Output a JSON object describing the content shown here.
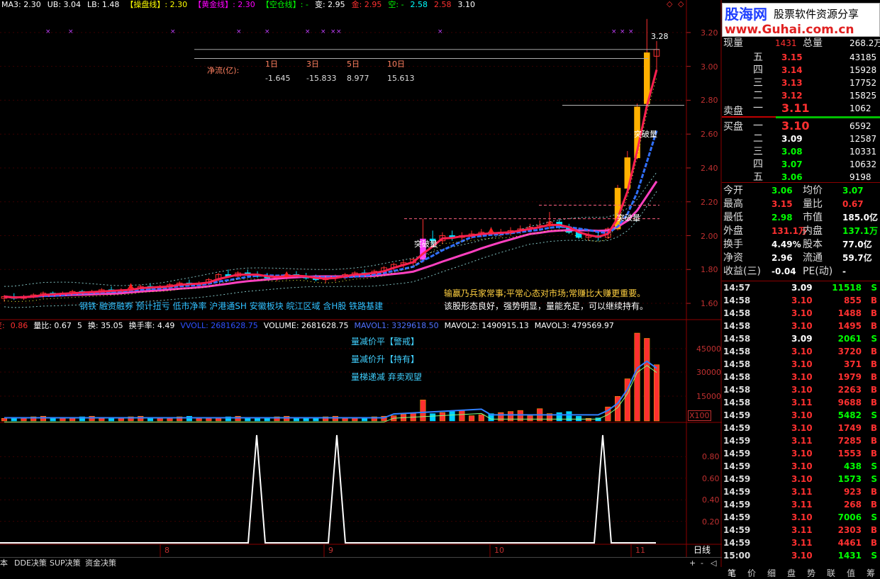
{
  "colors": {
    "up": "#ff3030",
    "down": "#00ffff",
    "neutral": "#ffffff",
    "bg": "#000000",
    "grid": "#8b0000",
    "accent": "#ff00ff",
    "yellow": "#ffff00",
    "green": "#00ff00"
  },
  "header": {
    "items": [
      {
        "t": "MA3: 2.30",
        "c": "#ffffff"
      },
      {
        "t": "UB: 3.04",
        "c": "#ffffff"
      },
      {
        "t": "LB: 1.48",
        "c": "#ffffff"
      },
      {
        "t": "【操盘线】: 2.30",
        "c": "#ffff00"
      },
      {
        "t": "【黄金线】: 2.30",
        "c": "#ff00ff"
      },
      {
        "t": "【空仓线】: -",
        "c": "#00ff00"
      },
      {
        "t": "变: 2.95",
        "c": "#ffffff"
      },
      {
        "t": "金: 2.95",
        "c": "#ff3030"
      },
      {
        "t": "空: -",
        "c": "#00ff00"
      },
      {
        "t": "2.58",
        "c": "#00ffff"
      },
      {
        "t": "2.58",
        "c": "#ff3030"
      },
      {
        "t": "3.10",
        "c": "#ffffff"
      }
    ]
  },
  "netflow": {
    "label": "净流(亿):",
    "cols": [
      "1日",
      "3日",
      "5日",
      "10日"
    ],
    "vals": [
      "-1.645",
      "-15.833",
      "8.977",
      "15.613"
    ]
  },
  "annotations": {
    "breakthrough": "突破量",
    "high_price": "3.28",
    "concepts": "钢铁 融资融券 预计扭亏 低市净率 沪港通SH 安徽板块 皖江区域 含H股 铁路基建",
    "comment1": "输赢乃兵家常事;平常心态对市场;常赚比大赚更重要。",
    "comment2": "该股形态良好，强势明显，量能充足，可以继续持有。"
  },
  "price_axis": [
    "3.20",
    "3.00",
    "2.80",
    "2.60",
    "2.40",
    "2.20",
    "2.00",
    "1.80",
    "1.60"
  ],
  "volume_header": [
    {
      "t": "变:",
      "c": "#ff3030"
    },
    {
      "t": "0.86",
      "c": "#ff3030"
    },
    {
      "t": "量比: 0.67",
      "c": "#ffffff"
    },
    {
      "t": "5",
      "c": "#ffffff"
    },
    {
      "t": "换: 35.05",
      "c": "#ffffff"
    },
    {
      "t": "换手率: 4.49",
      "c": "#ffffff"
    },
    {
      "t": "VVOLL: 2681628.75",
      "c": "#3050ff"
    },
    {
      "t": "VOLUME: 2681628.75",
      "c": "#ffffff"
    },
    {
      "t": "MAVOL1: 3329618.50",
      "c": "#5070ff"
    },
    {
      "t": "MAVOL2: 1490915.13",
      "c": "#ffffff"
    },
    {
      "t": "MAVOL3: 479569.97",
      "c": "#ffffff"
    }
  ],
  "volume_signals": [
    "量减价平【警戒】",
    "量减价升【持有】",
    "量梯递减 弃卖观望"
  ],
  "volume_axis": [
    "45000",
    "30000",
    "15000",
    "X100"
  ],
  "indicator_axis": [
    "0.80",
    "0.60",
    "0.40",
    "0.20"
  ],
  "date_axis": {
    "labels": [
      "8",
      "9",
      "10",
      "11"
    ],
    "period": "日线"
  },
  "bottom_tabs": [
    "本",
    "DDE决策",
    "SUP决策",
    "资金决策"
  ],
  "scroll_buttons": [
    "+",
    "-",
    "◁",
    "▷"
  ],
  "logo": {
    "title": "股海网",
    "subtitle": "股票软件资源分享",
    "url": "www.Guhai.com.cn"
  },
  "quote": {
    "top": [
      {
        "l": "现量",
        "v": "1431",
        "l2": "总量",
        "v2": "268.2万"
      }
    ],
    "sell": [
      {
        "l": "五",
        "p": "3.15",
        "v": "43185"
      },
      {
        "l": "四",
        "p": "3.14",
        "v": "15928"
      },
      {
        "l": "三",
        "p": "3.13",
        "v": "17752"
      },
      {
        "l": "二",
        "p": "3.12",
        "v": "15825"
      },
      {
        "l": "一",
        "p": "3.11",
        "v": "1062"
      }
    ],
    "sell_label": "卖盘",
    "buy_label": "买盘",
    "buy": [
      {
        "l": "一",
        "p": "3.10",
        "v": "6592"
      },
      {
        "l": "二",
        "p": "3.09",
        "v": "12587"
      },
      {
        "l": "三",
        "p": "3.08",
        "v": "10331"
      },
      {
        "l": "四",
        "p": "3.07",
        "v": "10632"
      },
      {
        "l": "五",
        "p": "3.06",
        "v": "9198"
      }
    ],
    "stats": [
      {
        "l": "今开",
        "v": "3.06",
        "c": "#00ff00",
        "l2": "均价",
        "v2": "3.07",
        "c2": "#00ff00"
      },
      {
        "l": "最高",
        "v": "3.15",
        "c": "#ff3030",
        "l2": "量比",
        "v2": "0.67",
        "c2": "#ff3030"
      },
      {
        "l": "最低",
        "v": "2.98",
        "c": "#00ff00",
        "l2": "市值",
        "v2": "185.0亿",
        "c2": "#ffffff"
      },
      {
        "l": "外盘",
        "v": "131.1万",
        "c": "#ff3030",
        "l2": "内盘",
        "v2": "137.1万",
        "c2": "#00ff00"
      },
      {
        "l": "换手",
        "v": "4.49%",
        "c": "#ffffff",
        "l2": "股本",
        "v2": "77.0亿",
        "c2": "#ffffff"
      },
      {
        "l": "净资",
        "v": "2.96",
        "c": "#ffffff",
        "l2": "流通",
        "v2": "59.7亿",
        "c2": "#ffffff"
      },
      {
        "l": "收益(三)",
        "v": "-0.04",
        "c": "#ffffff",
        "l2": "PE(动)",
        "v2": "-",
        "c2": "#ffffff"
      }
    ]
  },
  "ticks": [
    {
      "t": "14:57",
      "p": "3.09",
      "v": "11518",
      "d": "S"
    },
    {
      "t": "14:58",
      "p": "3.10",
      "v": "855",
      "d": "B"
    },
    {
      "t": "14:58",
      "p": "3.10",
      "v": "1488",
      "d": "B"
    },
    {
      "t": "14:58",
      "p": "3.10",
      "v": "1495",
      "d": "B"
    },
    {
      "t": "14:58",
      "p": "3.09",
      "v": "2061",
      "d": "S"
    },
    {
      "t": "14:58",
      "p": "3.10",
      "v": "3720",
      "d": "B"
    },
    {
      "t": "14:58",
      "p": "3.10",
      "v": "371",
      "d": "B"
    },
    {
      "t": "14:58",
      "p": "3.10",
      "v": "1979",
      "d": "B"
    },
    {
      "t": "14:58",
      "p": "3.10",
      "v": "2263",
      "d": "B"
    },
    {
      "t": "14:58",
      "p": "3.11",
      "v": "9688",
      "d": "B"
    },
    {
      "t": "14:59",
      "p": "3.10",
      "v": "5482",
      "d": "S"
    },
    {
      "t": "14:59",
      "p": "3.10",
      "v": "1749",
      "d": "B"
    },
    {
      "t": "14:59",
      "p": "3.11",
      "v": "7285",
      "d": "B"
    },
    {
      "t": "14:59",
      "p": "3.10",
      "v": "1553",
      "d": "B"
    },
    {
      "t": "14:59",
      "p": "3.10",
      "v": "438",
      "d": "S"
    },
    {
      "t": "14:59",
      "p": "3.10",
      "v": "1573",
      "d": "S"
    },
    {
      "t": "14:59",
      "p": "3.11",
      "v": "923",
      "d": "B"
    },
    {
      "t": "14:59",
      "p": "3.11",
      "v": "268",
      "d": "B"
    },
    {
      "t": "14:59",
      "p": "3.10",
      "v": "7006",
      "d": "S"
    },
    {
      "t": "14:59",
      "p": "3.11",
      "v": "2303",
      "d": "B"
    },
    {
      "t": "14:59",
      "p": "3.11",
      "v": "4461",
      "d": "B"
    },
    {
      "t": "15:00",
      "p": "3.10",
      "v": "1431",
      "d": "S"
    }
  ],
  "side_tabs": [
    "笔",
    "价",
    "细",
    "盘",
    "势",
    "联",
    "值",
    "筹"
  ],
  "chart_data": {
    "type": "candlestick",
    "ylim": [
      1.55,
      3.3
    ],
    "candles": [
      [
        1.63,
        1.65,
        1.61,
        1.64
      ],
      [
        1.64,
        1.66,
        1.62,
        1.63
      ],
      [
        1.63,
        1.65,
        1.62,
        1.64
      ],
      [
        1.64,
        1.66,
        1.63,
        1.65
      ],
      [
        1.65,
        1.67,
        1.63,
        1.66
      ],
      [
        1.66,
        1.67,
        1.64,
        1.65
      ],
      [
        1.65,
        1.67,
        1.64,
        1.66
      ],
      [
        1.66,
        1.68,
        1.65,
        1.67
      ],
      [
        1.67,
        1.68,
        1.65,
        1.66
      ],
      [
        1.66,
        1.68,
        1.65,
        1.67
      ],
      [
        1.67,
        1.69,
        1.66,
        1.68
      ],
      [
        1.68,
        1.7,
        1.66,
        1.67
      ],
      [
        1.67,
        1.69,
        1.66,
        1.68
      ],
      [
        1.68,
        1.7,
        1.67,
        1.69
      ],
      [
        1.69,
        1.71,
        1.67,
        1.7
      ],
      [
        1.7,
        1.72,
        1.68,
        1.69
      ],
      [
        1.69,
        1.71,
        1.68,
        1.7
      ],
      [
        1.7,
        1.72,
        1.69,
        1.71
      ],
      [
        1.71,
        1.73,
        1.7,
        1.72
      ],
      [
        1.72,
        1.74,
        1.7,
        1.71
      ],
      [
        1.71,
        1.73,
        1.7,
        1.72
      ],
      [
        1.72,
        1.75,
        1.71,
        1.74
      ],
      [
        1.74,
        1.78,
        1.73,
        1.77
      ],
      [
        1.77,
        1.8,
        1.75,
        1.76
      ],
      [
        1.76,
        1.79,
        1.74,
        1.78
      ],
      [
        1.78,
        1.8,
        1.76,
        1.77
      ],
      [
        1.77,
        1.79,
        1.75,
        1.76
      ],
      [
        1.76,
        1.78,
        1.74,
        1.75
      ],
      [
        1.75,
        1.77,
        1.73,
        1.76
      ],
      [
        1.76,
        1.78,
        1.74,
        1.77
      ],
      [
        1.77,
        1.79,
        1.75,
        1.76
      ],
      [
        1.76,
        1.78,
        1.74,
        1.75
      ],
      [
        1.75,
        1.77,
        1.73,
        1.74
      ],
      [
        1.74,
        1.76,
        1.72,
        1.75
      ],
      [
        1.75,
        1.77,
        1.73,
        1.76
      ],
      [
        1.76,
        1.78,
        1.74,
        1.77
      ],
      [
        1.77,
        1.79,
        1.75,
        1.78
      ],
      [
        1.78,
        1.8,
        1.76,
        1.77
      ],
      [
        1.77,
        1.8,
        1.76,
        1.79
      ],
      [
        1.79,
        1.82,
        1.77,
        1.81
      ],
      [
        1.81,
        1.84,
        1.79,
        1.83
      ],
      [
        1.83,
        1.86,
        1.81,
        1.84
      ],
      [
        1.84,
        1.87,
        1.82,
        1.86
      ],
      [
        1.86,
        2.1,
        1.84,
        1.98
      ],
      [
        1.98,
        2.03,
        1.93,
        1.97
      ],
      [
        1.97,
        2.02,
        1.95,
        2.0
      ],
      [
        2.0,
        2.03,
        1.97,
        1.99
      ],
      [
        1.99,
        2.02,
        1.96,
        2.0
      ],
      [
        2.0,
        2.03,
        1.98,
        2.01
      ],
      [
        2.01,
        2.04,
        1.99,
        2.02
      ],
      [
        2.02,
        2.05,
        2.0,
        2.01
      ],
      [
        2.01,
        2.04,
        1.99,
        2.02
      ],
      [
        2.02,
        2.05,
        2.0,
        2.03
      ],
      [
        2.03,
        2.06,
        2.01,
        2.04
      ],
      [
        2.04,
        2.07,
        2.02,
        2.05
      ],
      [
        2.05,
        2.09,
        2.03,
        2.06
      ],
      [
        2.06,
        2.14,
        2.04,
        2.08
      ],
      [
        2.08,
        2.1,
        2.04,
        2.05
      ],
      [
        2.05,
        2.07,
        2.01,
        2.02
      ],
      [
        2.02,
        2.04,
        1.98,
        1.99
      ],
      [
        1.99,
        2.02,
        1.97,
        2.0
      ],
      [
        2.0,
        2.02,
        1.97,
        1.99
      ],
      [
        1.99,
        2.05,
        1.98,
        2.04
      ],
      [
        2.04,
        2.3,
        2.03,
        2.28
      ],
      [
        2.28,
        2.5,
        2.26,
        2.46
      ],
      [
        2.46,
        2.78,
        2.45,
        2.76
      ],
      [
        2.78,
        3.28,
        2.75,
        3.08
      ],
      [
        3.06,
        3.15,
        2.98,
        3.1
      ]
    ]
  }
}
